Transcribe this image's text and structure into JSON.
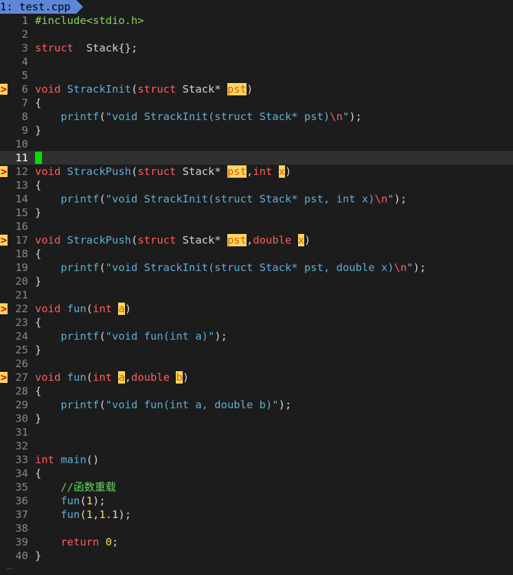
{
  "tab": {
    "label": "1: test.cpp",
    "bg": "#5f87d7"
  },
  "tilde": "~",
  "sign_marker": ">",
  "colors": {
    "background": "#1c1c1c",
    "keyword": "#ff5f5f",
    "function": "#5fafd7",
    "preproc": "#87d75f",
    "number": "#ffd75f",
    "comment": "#5fd75f",
    "highlight": "#ffd75f",
    "cursor": "#00e000"
  },
  "cursor_line": 11,
  "lines": [
    {
      "n": "1",
      "sign": false,
      "tokens": [
        [
          "pp",
          "#include<stdio.h>"
        ]
      ]
    },
    {
      "n": "2",
      "sign": false,
      "tokens": []
    },
    {
      "n": "3",
      "sign": false,
      "tokens": [
        [
          "kw",
          "struct"
        ],
        [
          "",
          "  Stack{};"
        ]
      ]
    },
    {
      "n": "4",
      "sign": false,
      "tokens": []
    },
    {
      "n": "5",
      "sign": false,
      "tokens": []
    },
    {
      "n": "6",
      "sign": true,
      "tokens": [
        [
          "kw",
          "void"
        ],
        [
          "",
          " "
        ],
        [
          "fn",
          "StrackInit"
        ],
        [
          "",
          "("
        ],
        [
          "kw",
          "struct"
        ],
        [
          "",
          " Stack* "
        ],
        [
          "hl",
          "pst"
        ],
        [
          "",
          ")"
        ]
      ]
    },
    {
      "n": "7",
      "sign": false,
      "tokens": [
        [
          "",
          "{"
        ]
      ]
    },
    {
      "n": "8",
      "sign": false,
      "tokens": [
        [
          "",
          "    "
        ],
        [
          "fn",
          "printf"
        ],
        [
          "",
          "("
        ],
        [
          "str",
          "\"void StrackInit(struct Stack* pst)"
        ],
        [
          "esc",
          "\\n"
        ],
        [
          "str",
          "\""
        ],
        [
          "",
          ");"
        ]
      ]
    },
    {
      "n": "9",
      "sign": false,
      "tokens": [
        [
          "",
          "}"
        ]
      ]
    },
    {
      "n": "10",
      "sign": false,
      "tokens": []
    },
    {
      "n": "11",
      "sign": false,
      "tokens": []
    },
    {
      "n": "12",
      "sign": true,
      "tokens": [
        [
          "kw",
          "void"
        ],
        [
          "",
          " "
        ],
        [
          "fn",
          "StrackPush"
        ],
        [
          "",
          "("
        ],
        [
          "kw",
          "struct"
        ],
        [
          "",
          " Stack* "
        ],
        [
          "hl",
          "pst"
        ],
        [
          "",
          ","
        ],
        [
          "kw",
          "int"
        ],
        [
          "",
          " "
        ],
        [
          "hl",
          "x"
        ],
        [
          "",
          ")"
        ]
      ]
    },
    {
      "n": "13",
      "sign": false,
      "tokens": [
        [
          "",
          "{"
        ]
      ]
    },
    {
      "n": "14",
      "sign": false,
      "tokens": [
        [
          "",
          "    "
        ],
        [
          "fn",
          "printf"
        ],
        [
          "",
          "("
        ],
        [
          "str",
          "\"void StrackInit(struct Stack* pst, int x)"
        ],
        [
          "esc",
          "\\n"
        ],
        [
          "str",
          "\""
        ],
        [
          "",
          ");"
        ]
      ]
    },
    {
      "n": "15",
      "sign": false,
      "tokens": [
        [
          "",
          "}"
        ]
      ]
    },
    {
      "n": "16",
      "sign": false,
      "tokens": []
    },
    {
      "n": "17",
      "sign": true,
      "tokens": [
        [
          "kw",
          "void"
        ],
        [
          "",
          " "
        ],
        [
          "fn",
          "StrackPush"
        ],
        [
          "",
          "("
        ],
        [
          "kw",
          "struct"
        ],
        [
          "",
          " Stack* "
        ],
        [
          "hl",
          "pst"
        ],
        [
          "",
          ","
        ],
        [
          "kw",
          "double"
        ],
        [
          "",
          " "
        ],
        [
          "hl",
          "x"
        ],
        [
          "",
          ")"
        ]
      ]
    },
    {
      "n": "18",
      "sign": false,
      "tokens": [
        [
          "",
          "{"
        ]
      ]
    },
    {
      "n": "19",
      "sign": false,
      "tokens": [
        [
          "",
          "    "
        ],
        [
          "fn",
          "printf"
        ],
        [
          "",
          "("
        ],
        [
          "str",
          "\"void StrackInit(struct Stack* pst, double x)"
        ],
        [
          "esc",
          "\\n"
        ],
        [
          "str",
          "\""
        ],
        [
          "",
          ");"
        ]
      ]
    },
    {
      "n": "20",
      "sign": false,
      "tokens": [
        [
          "",
          "}"
        ]
      ]
    },
    {
      "n": "21",
      "sign": false,
      "tokens": []
    },
    {
      "n": "22",
      "sign": true,
      "tokens": [
        [
          "kw",
          "void"
        ],
        [
          "",
          " "
        ],
        [
          "fn",
          "fun"
        ],
        [
          "",
          "("
        ],
        [
          "kw",
          "int"
        ],
        [
          "",
          " "
        ],
        [
          "hl",
          "a"
        ],
        [
          "",
          ")"
        ]
      ]
    },
    {
      "n": "23",
      "sign": false,
      "tokens": [
        [
          "",
          "{"
        ]
      ]
    },
    {
      "n": "24",
      "sign": false,
      "tokens": [
        [
          "",
          "    "
        ],
        [
          "fn",
          "printf"
        ],
        [
          "",
          "("
        ],
        [
          "str",
          "\"void fun(int a)\""
        ],
        [
          "",
          ");"
        ]
      ]
    },
    {
      "n": "25",
      "sign": false,
      "tokens": [
        [
          "",
          "}"
        ]
      ]
    },
    {
      "n": "26",
      "sign": false,
      "tokens": []
    },
    {
      "n": "27",
      "sign": true,
      "tokens": [
        [
          "kw",
          "void"
        ],
        [
          "",
          " "
        ],
        [
          "fn",
          "fun"
        ],
        [
          "",
          "("
        ],
        [
          "kw",
          "int"
        ],
        [
          "",
          " "
        ],
        [
          "hl",
          "a"
        ],
        [
          "",
          ","
        ],
        [
          "kw",
          "double"
        ],
        [
          "",
          " "
        ],
        [
          "hl",
          "b"
        ],
        [
          "",
          ")"
        ]
      ]
    },
    {
      "n": "28",
      "sign": false,
      "tokens": [
        [
          "",
          "{"
        ]
      ]
    },
    {
      "n": "29",
      "sign": false,
      "tokens": [
        [
          "",
          "    "
        ],
        [
          "fn",
          "printf"
        ],
        [
          "",
          "("
        ],
        [
          "str",
          "\"void fun(int a, double b)\""
        ],
        [
          "",
          ");"
        ]
      ]
    },
    {
      "n": "30",
      "sign": false,
      "tokens": [
        [
          "",
          "}"
        ]
      ]
    },
    {
      "n": "31",
      "sign": false,
      "tokens": []
    },
    {
      "n": "32",
      "sign": false,
      "tokens": []
    },
    {
      "n": "33",
      "sign": false,
      "tokens": [
        [
          "kw",
          "int"
        ],
        [
          "",
          " "
        ],
        [
          "fn",
          "main"
        ],
        [
          "",
          "()"
        ]
      ]
    },
    {
      "n": "34",
      "sign": false,
      "tokens": [
        [
          "",
          "{"
        ]
      ]
    },
    {
      "n": "35",
      "sign": false,
      "tokens": [
        [
          "",
          "    "
        ],
        [
          "cmt",
          "//函数重载"
        ]
      ]
    },
    {
      "n": "36",
      "sign": false,
      "tokens": [
        [
          "",
          "    "
        ],
        [
          "fn",
          "fun"
        ],
        [
          "",
          "("
        ],
        [
          "num",
          "1"
        ],
        [
          "",
          ");"
        ]
      ]
    },
    {
      "n": "37",
      "sign": false,
      "tokens": [
        [
          "",
          "    "
        ],
        [
          "fn",
          "fun"
        ],
        [
          "",
          "("
        ],
        [
          "num",
          "1"
        ],
        [
          "",
          ","
        ],
        [
          "num",
          "1.1"
        ],
        [
          "",
          ");"
        ]
      ]
    },
    {
      "n": "38",
      "sign": false,
      "tokens": []
    },
    {
      "n": "39",
      "sign": false,
      "tokens": [
        [
          "",
          "    "
        ],
        [
          "kw",
          "return"
        ],
        [
          "",
          " "
        ],
        [
          "num",
          "0"
        ],
        [
          "",
          ";"
        ]
      ]
    },
    {
      "n": "40",
      "sign": false,
      "tokens": [
        [
          "",
          "}"
        ]
      ]
    }
  ]
}
